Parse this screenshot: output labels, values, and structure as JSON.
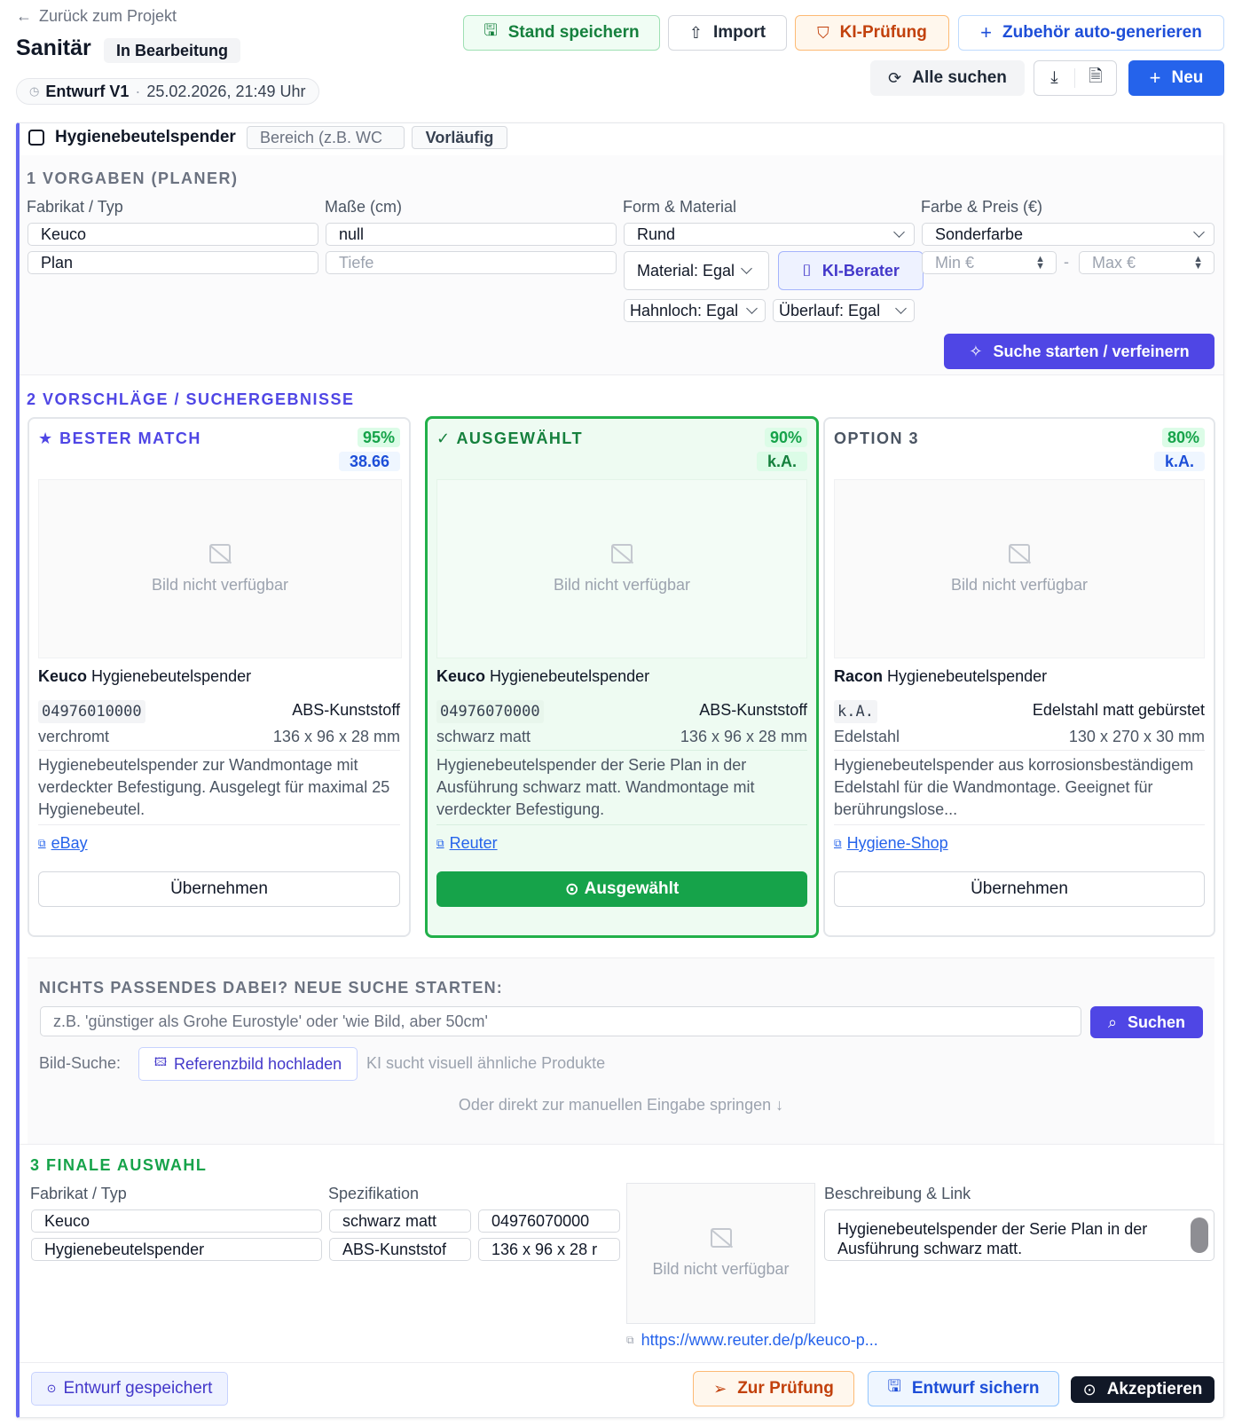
{
  "header": {
    "back_label": "Zurück zum Projekt",
    "title": "Sanitär",
    "status": "In Bearbeitung",
    "draft_label": "Entwurf V1",
    "draft_separator": "·",
    "draft_date": "25.02.2026, 21:49 Uhr"
  },
  "toolbar": {
    "save_state": "Stand speichern",
    "import": "Import",
    "ki_check": "KI-Prüfung",
    "accessory": "Zubehör auto-generieren",
    "find_all": "Alle suchen",
    "new": "Neu"
  },
  "item": {
    "name": "Hygienebeutelspender",
    "area_placeholder": "Bereich (z.B. WC",
    "state": "Vorläufig"
  },
  "section1": {
    "title": "1 VORGABEN (PLANER)",
    "label_maker": "Fabrikat / Typ",
    "label_dims": "Maße (cm)",
    "label_form": "Form & Material",
    "label_color": "Farbe & Preis (€)",
    "maker": "Keuco",
    "type": "Plan",
    "dims": "null",
    "depth_placeholder": "Tiefe",
    "form": "Rund",
    "material": "Material: Egal",
    "ki_advisor": "KI-Berater",
    "color": "Sonderfarbe",
    "min_placeholder": "Min €",
    "range_sep": "-",
    "max_placeholder": "Max €",
    "tap_hole": "Hahnloch: Egal",
    "overflow": "Überlauf: Egal",
    "search_btn": "Suche starten / verfeinern"
  },
  "section2": {
    "title": "2 VORSCHLÄGE / SUCHERGEBNISSE",
    "no_image": "Bild nicht verfügbar",
    "cards": [
      {
        "title": "BESTER MATCH",
        "percent": "95%",
        "price": "38.66",
        "brand": "Keuco",
        "product": "Hygienebeutelspender",
        "article": "04976010000",
        "material": "ABS-Kunststoff",
        "color": "verchromt",
        "dims": "136 x 96 x 28 mm",
        "description": "Hygienebeutelspender zur Wandmontage mit verdeckter Befestigung. Ausgelegt für maximal 25 Hygienebeutel.",
        "source": "eBay",
        "action": "Übernehmen"
      },
      {
        "title": "AUSGEWÄHLT",
        "percent": "90%",
        "price": "k.A.",
        "brand": "Keuco",
        "product": "Hygienebeutelspender",
        "article": "04976070000",
        "material": "ABS-Kunststoff",
        "color": "schwarz matt",
        "dims": "136 x 96 x 28 mm",
        "description": "Hygienebeutelspender der Serie Plan in der Ausführung schwarz matt. Wandmontage mit verdeckter Befestigung.",
        "source": "Reuter",
        "action": "Ausgewählt"
      },
      {
        "title": "OPTION 3",
        "percent": "80%",
        "price": "k.A.",
        "brand": "Racon",
        "product": "Hygienebeutelspender",
        "article": "k.A.",
        "material": "Edelstahl matt gebürstet",
        "color": "Edelstahl",
        "dims": "130 x 270 x 30 mm",
        "description": "Hygienebeutelspender aus korrosionsbeständigem Edelstahl für die Wandmontage. Geeignet für berührungslose...",
        "source": "Hygiene-Shop",
        "action": "Übernehmen"
      }
    ],
    "new_search_title": "NICHTS PASSENDES DABEI? NEUE SUCHE STARTEN:",
    "new_search_placeholder": "z.B. 'günstiger als Grohe Eurostyle' oder 'wie Bild, aber 50cm'",
    "search_label": "Suchen",
    "image_search_label": "Bild-Suche:",
    "upload_label": "Referenzbild hochladen",
    "upload_hint": "KI sucht visuell ähnliche Produkte",
    "manual_jump": "Oder direkt zur manuellen Eingabe springen ↓"
  },
  "section3": {
    "title": "3 FINALE AUSWAHL",
    "label_maker": "Fabrikat / Typ",
    "label_spec": "Spezifikation",
    "label_desc": "Beschreibung & Link",
    "maker": "Keuco",
    "type": "Hygienebeutelspender",
    "color": "schwarz matt",
    "article": "04976070000",
    "material": "ABS-Kunststof",
    "dims": "136 x 96 x 28 r",
    "no_image": "Bild nicht verfügbar",
    "description": "Hygienebeutelspender der Serie Plan in der Ausführung schwarz matt.",
    "url": "https://www.reuter.de/p/keuco-p..."
  },
  "footer": {
    "saved": "Entwurf gespeichert",
    "to_review": "Zur Prüfung",
    "save_draft": "Entwurf sichern",
    "accept": "Akzeptieren"
  },
  "colors": {
    "accent": "#4f46e5",
    "success": "#16a34a",
    "warning": "#c2410c",
    "primary_blue": "#2563eb"
  }
}
